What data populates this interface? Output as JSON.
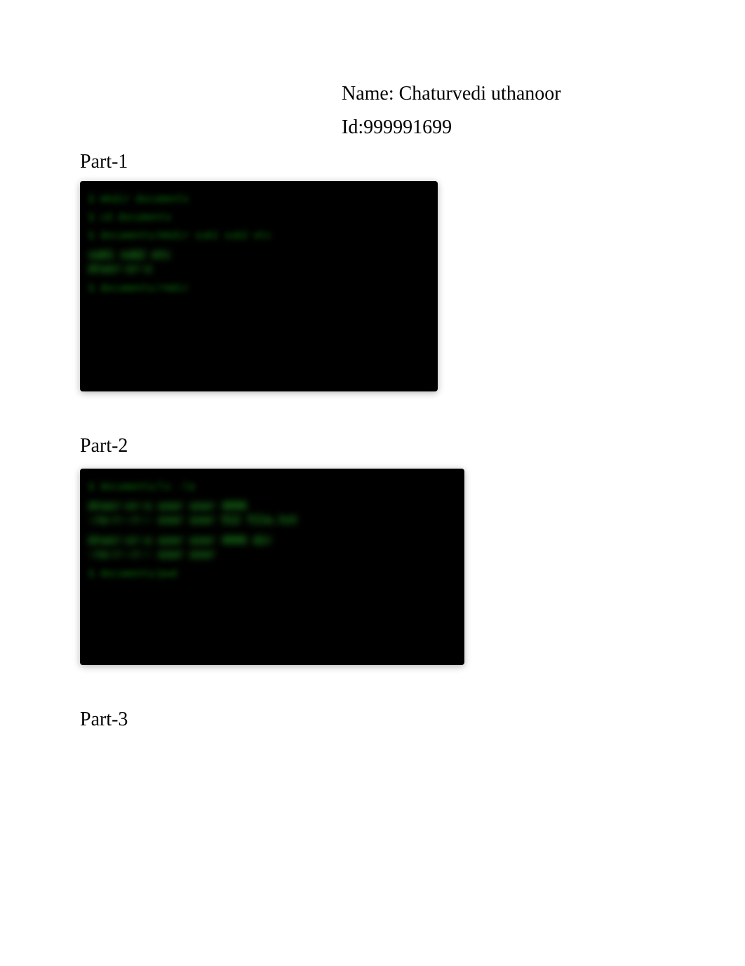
{
  "header": {
    "name_label": "Name: Chaturvedi uthanoor",
    "id_label": "Id:999991699"
  },
  "sections": {
    "part1": {
      "title": "Part-1",
      "terminal_lines": [
        "$ mkdir documents",
        "$ cd documents",
        "$ documents/mkdir sub1 sub2 etc",
        "sub1 sub2 etc",
        "drwxr-xr-x",
        "$ documents/rmdir"
      ]
    },
    "part2": {
      "title": "Part-2",
      "terminal_lines": [
        "$ documents/ls -la",
        "drwxr-xr-x  user user  4096",
        "-rw-r--r--  user user   512  file.txt",
        "drwxr-xr-x  user user  4096 dir",
        "-rw-r--r--  user user",
        "$ documents/pwd"
      ]
    },
    "part3": {
      "title": "Part-3"
    }
  }
}
